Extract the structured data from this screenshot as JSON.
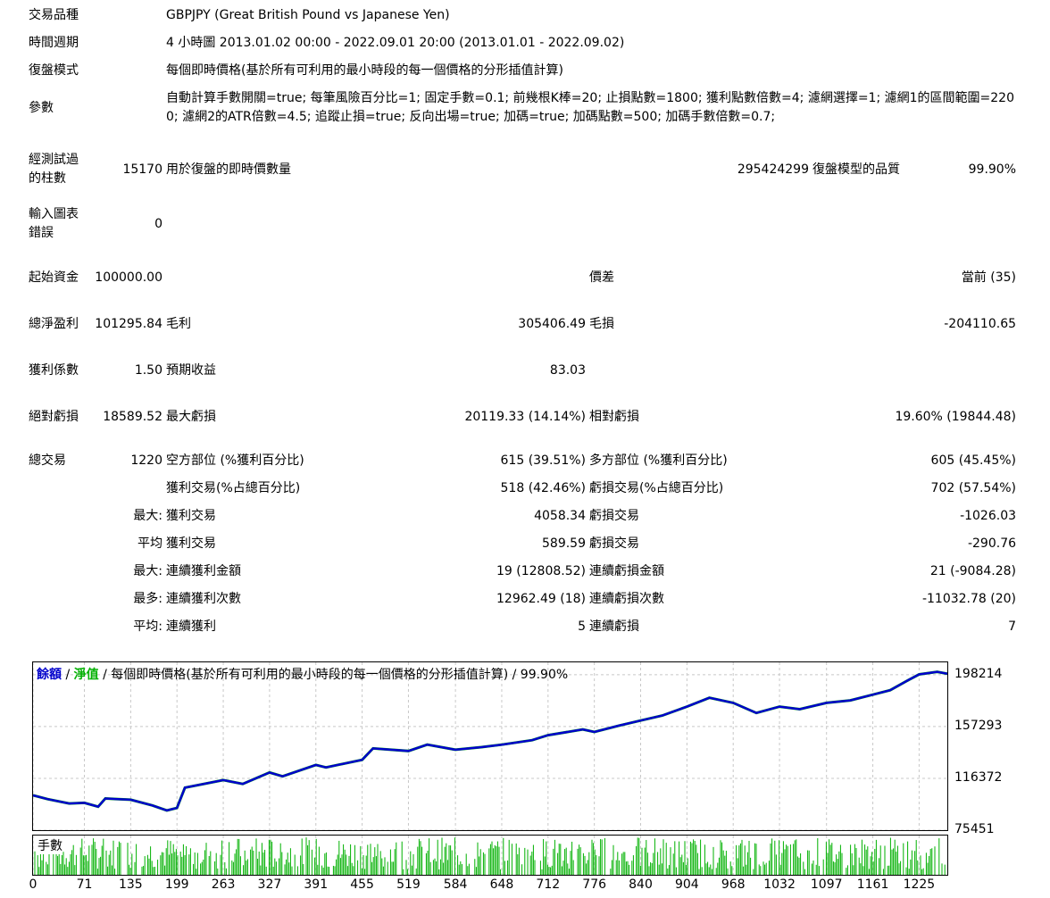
{
  "header": {
    "symbol_label": "交易品種",
    "symbol_value": "GBPJPY (Great British Pound vs Japanese Yen)",
    "period_label": "時間週期",
    "period_value": "4 小時圖 2013.01.02 00:00 - 2022.09.01 20:00 (2013.01.01 - 2022.09.02)",
    "model_label": "復盤模式",
    "model_value": "每個即時價格(基於所有可利用的最小時段的每一個價格的分形插值計算)",
    "params_label": "參數",
    "params_value": "自動計算手數開關=true; 每筆風險百分比=1; 固定手數=0.1; 前幾根K棒=20; 止損點數=1800; 獲利點數倍數=4; 濾網選擇=1; 濾網1的區間範圍=2200; 濾網2的ATR倍數=4.5; 追蹤止損=true; 反向出場=true; 加碼=true; 加碼點數=500; 加碼手數倍數=0.7;"
  },
  "stats": {
    "bars_label": "經測試過的柱數",
    "bars_value": "15170",
    "ticks_label": "用於復盤的即時價數量",
    "ticks_value": "295424299",
    "quality_label": "復盤模型的品質",
    "quality_value": "99.90%",
    "errors_label": "輸入圖表錯誤",
    "errors_value": "0",
    "deposit_label": "起始資金",
    "deposit_value": "100000.00",
    "spread_label": "價差",
    "spread_value": "當前 (35)",
    "net_label": "總淨盈利",
    "net_value": "101295.84",
    "gross_profit_label": "毛利",
    "gross_profit_value": "305406.49",
    "gross_loss_label": "毛損",
    "gross_loss_value": "-204110.65",
    "pf_label": "獲利係數",
    "pf_value": "1.50",
    "payoff_label": "預期收益",
    "payoff_value": "83.03",
    "abs_dd_label": "絕對虧損",
    "abs_dd_value": "18589.52",
    "max_dd_label": "最大虧損",
    "max_dd_value": "20119.33 (14.14%)",
    "rel_dd_label": "相對虧損",
    "rel_dd_value": "19.60% (19844.48)"
  },
  "trades": {
    "total_label": "總交易",
    "total_value": "1220",
    "short_label": "空方部位 (%獲利百分比)",
    "short_value": "615 (39.51%)",
    "long_label": "多方部位 (%獲利百分比)",
    "long_value": "605 (45.45%)",
    "profit_trades_label": "獲利交易(%占總百分比)",
    "profit_trades_value": "518 (42.46%)",
    "loss_trades_label": "虧損交易(%占總百分比)",
    "loss_trades_value": "702 (57.54%)",
    "largest_label": "最大:",
    "largest_profit_label": "獲利交易",
    "largest_profit_value": "4058.34",
    "largest_loss_label": "虧損交易",
    "largest_loss_value": "-1026.03",
    "average_label": "平均",
    "average_profit_label": "獲利交易",
    "average_profit_value": "589.59",
    "average_loss_label": "虧損交易",
    "average_loss_value": "-290.76",
    "max_label": "最大:",
    "max_cons_wins_label": "連續獲利金額",
    "max_cons_wins_value": "19 (12808.52)",
    "max_cons_losses_label": "連續虧損金額",
    "max_cons_losses_value": "21 (-9084.28)",
    "most_label": "最多:",
    "most_cons_profit_label": "連續獲利次數",
    "most_cons_profit_value": "12962.49 (18)",
    "most_cons_loss_label": "連續虧損次數",
    "most_cons_loss_value": "-11032.78 (20)",
    "avg_label": "平均:",
    "avg_cons_wins_label": "連續獲利",
    "avg_cons_wins_value": "5",
    "avg_cons_losses_label": "連續虧損",
    "avg_cons_losses_value": "7"
  },
  "chart": {
    "balance_label": "餘額",
    "sep1": " / ",
    "equity_label": "淨值",
    "sep2": " / ",
    "model_text": "每個即時價格(基於所有可利用的最小時段的每一個價格的分形插值計算) / 99.90%",
    "lots_label": "手數",
    "balance_color": "#0000cc",
    "equity_color": "#00b000",
    "lots_color": "#00b000"
  },
  "chart_data": {
    "type": "line",
    "title": "",
    "y_ticks": [
      "198214",
      "157293",
      "116372",
      "75451"
    ],
    "x_ticks": [
      "0",
      "71",
      "135",
      "199",
      "263",
      "327",
      "391",
      "455",
      "519",
      "584",
      "648",
      "712",
      "776",
      "840",
      "904",
      "968",
      "1032",
      "1097",
      "1161",
      "1225"
    ],
    "ylim": [
      75451,
      208000
    ],
    "xlim": [
      0,
      1264
    ],
    "series": [
      {
        "name": "餘額",
        "x": [
          0,
          20,
          50,
          71,
          90,
          100,
          135,
          165,
          185,
          199,
          210,
          263,
          290,
          327,
          345,
          391,
          405,
          455,
          470,
          519,
          545,
          584,
          620,
          648,
          690,
          712,
          760,
          776,
          810,
          840,
          870,
          904,
          935,
          968,
          1000,
          1032,
          1060,
          1097,
          1130,
          1161,
          1185,
          1210,
          1225,
          1250,
          1264
        ],
        "values": [
          103000,
          100000,
          96500,
          97000,
          94000,
          100500,
          99500,
          95000,
          91000,
          93000,
          109000,
          115000,
          112000,
          121000,
          118000,
          127000,
          125000,
          131000,
          140000,
          138000,
          143000,
          139000,
          141000,
          143000,
          146500,
          150500,
          155000,
          153000,
          158000,
          162000,
          166000,
          173000,
          180000,
          176000,
          168000,
          173000,
          171000,
          176000,
          178000,
          182500,
          186000,
          194000,
          198500,
          200500,
          199000
        ]
      },
      {
        "name": "淨值",
        "x": [
          0,
          20,
          50,
          71,
          90,
          100,
          135,
          165,
          185,
          199,
          210,
          263,
          290,
          327,
          345,
          391,
          405,
          455,
          470,
          519,
          545,
          584,
          620,
          648,
          690,
          712,
          760,
          776,
          810,
          840,
          870,
          904,
          935,
          968,
          1000,
          1032,
          1060,
          1097,
          1130,
          1161,
          1185,
          1210,
          1225,
          1250,
          1264
        ],
        "values": [
          103000,
          100000,
          96500,
          97000,
          94000,
          100500,
          99500,
          95000,
          91000,
          93000,
          109000,
          115000,
          112000,
          121000,
          118000,
          127000,
          125000,
          131000,
          140000,
          138000,
          143000,
          139000,
          141000,
          143000,
          146500,
          150500,
          155000,
          153000,
          158000,
          162000,
          166000,
          173000,
          180000,
          176000,
          168000,
          173000,
          171000,
          176000,
          178000,
          182500,
          186000,
          194000,
          198500,
          200500,
          199000
        ]
      }
    ]
  }
}
